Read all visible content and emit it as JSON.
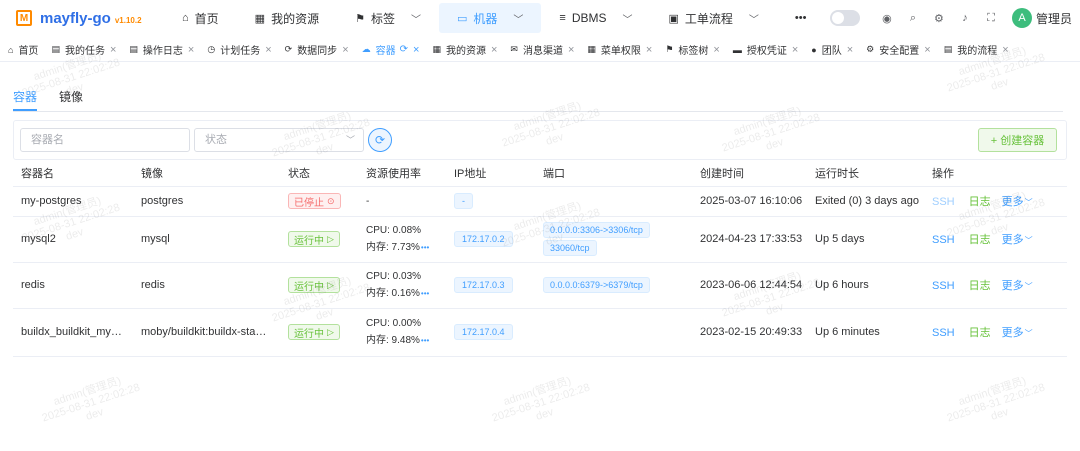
{
  "app": {
    "logo_glyph": "M",
    "name": "mayfly-go",
    "version": "v1.10.2"
  },
  "topnav": [
    {
      "icon": "home-icon",
      "glyph": "⌂",
      "label": "首页",
      "caret": false,
      "active": false
    },
    {
      "icon": "grid-icon",
      "glyph": "▦",
      "label": "我的资源",
      "caret": false,
      "active": false
    },
    {
      "icon": "bookmark-icon",
      "glyph": "⚑",
      "label": "标签",
      "caret": true,
      "active": false
    },
    {
      "icon": "monitor-icon",
      "glyph": "▭",
      "label": "机器",
      "caret": true,
      "active": true
    },
    {
      "icon": "database-icon",
      "glyph": "≡",
      "label": "DBMS",
      "caret": true,
      "active": false
    },
    {
      "icon": "briefcase-icon",
      "glyph": "▣",
      "label": "工单流程",
      "caret": true,
      "active": false
    },
    {
      "icon": "more-dots-icon",
      "glyph": "•••",
      "label": "",
      "caret": false,
      "active": false
    }
  ],
  "user": {
    "avatar_letter": "A",
    "name": "管理员"
  },
  "tabs": [
    {
      "label": "首页",
      "glyph": "⌂",
      "closable": false,
      "active": false
    },
    {
      "label": "我的任务",
      "glyph": "▤",
      "closable": true,
      "active": false
    },
    {
      "label": "操作日志",
      "glyph": "▤",
      "closable": true,
      "active": false
    },
    {
      "label": "计划任务",
      "glyph": "◷",
      "closable": true,
      "active": false
    },
    {
      "label": "数据同步",
      "glyph": "⟳",
      "closable": true,
      "active": false
    },
    {
      "label": "容器",
      "glyph": "☁",
      "closable": true,
      "active": true
    },
    {
      "label": "我的资源",
      "glyph": "▦",
      "closable": true,
      "active": false
    },
    {
      "label": "消息渠道",
      "glyph": "✉",
      "closable": true,
      "active": false
    },
    {
      "label": "菜单权限",
      "glyph": "▦",
      "closable": true,
      "active": false
    },
    {
      "label": "标签树",
      "glyph": "⚑",
      "closable": true,
      "active": false
    },
    {
      "label": "授权凭证",
      "glyph": "▬",
      "closable": true,
      "active": false
    },
    {
      "label": "团队",
      "glyph": "●",
      "closable": true,
      "active": false
    },
    {
      "label": "安全配置",
      "glyph": "⚙",
      "closable": true,
      "active": false
    },
    {
      "label": "我的流程",
      "glyph": "▤",
      "closable": true,
      "active": false
    }
  ],
  "subtabs": {
    "containers": "容器",
    "images": "镜像"
  },
  "toolbar": {
    "name_placeholder": "容器名",
    "status_placeholder": "状态",
    "create_label": "+ 创建容器"
  },
  "table": {
    "headers": [
      "容器名",
      "镜像",
      "状态",
      "资源使用率",
      "IP地址",
      "端口",
      "创建时间",
      "运行时长",
      "操作"
    ],
    "rows": [
      {
        "name": "my-postgres",
        "image": "postgres",
        "status": "已停止",
        "running": false,
        "cpu": "",
        "mem": "",
        "res_dash": "-",
        "ip": "-",
        "ports": [],
        "created": "2025-03-07 16:10:06",
        "uptime": "Exited (0) 3 days ago",
        "ssh_enabled": false
      },
      {
        "name": "mysql2",
        "image": "mysql",
        "status": "运行中",
        "running": true,
        "cpu": "CPU: 0.08%",
        "mem": "内存: 7.73%",
        "res_dash": "",
        "ip": "172.17.0.2",
        "ports": [
          "0.0.0.0:3306->3306/tcp",
          "33060/tcp"
        ],
        "created": "2024-04-23 17:33:53",
        "uptime": "Up 5 days",
        "ssh_enabled": true
      },
      {
        "name": "redis",
        "image": "redis",
        "status": "运行中",
        "running": true,
        "cpu": "CPU: 0.03%",
        "mem": "内存: 0.16%",
        "res_dash": "",
        "ip": "172.17.0.3",
        "ports": [
          "0.0.0.0:6379->6379/tcp"
        ],
        "created": "2023-06-06 12:44:54",
        "uptime": "Up 6 hours",
        "ssh_enabled": true
      },
      {
        "name": "buildx_buildkit_my…",
        "image": "moby/buildkit:buildx-sta…",
        "status": "运行中",
        "running": true,
        "cpu": "CPU: 0.00%",
        "mem": "内存: 9.48%",
        "res_dash": "",
        "ip": "172.17.0.4",
        "ports": [],
        "created": "2023-02-15 20:49:33",
        "uptime": "Up 6 minutes",
        "ssh_enabled": true
      }
    ],
    "actions": {
      "ssh": "SSH",
      "log": "日志",
      "more": "更多"
    }
  },
  "watermark": {
    "line1": "admin(管理员)",
    "line2": "2025-08-31 22:02:28",
    "line3": "dev"
  }
}
